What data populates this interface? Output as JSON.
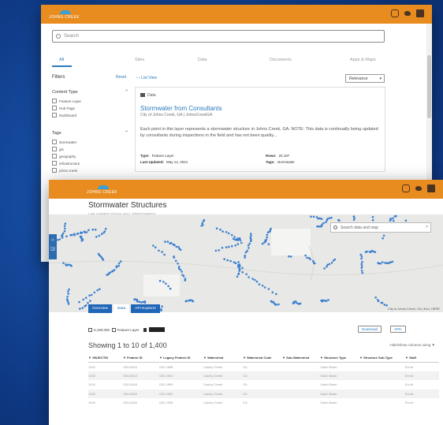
{
  "brand": {
    "logo_text": "JOHNS CREEK",
    "social_icons": [
      "instagram-icon",
      "twitter-icon",
      "facebook-icon"
    ],
    "colors": {
      "header": "#e88c1f",
      "accent": "#2a7ab9",
      "tab_blue": "#1f65b8",
      "background": "#174ea3",
      "map_points": "#3d7fd0"
    }
  },
  "search_page": {
    "search_placeholder": "Search",
    "tabs": [
      "All",
      "Sites",
      "Data",
      "Documents",
      "Apps & Maps"
    ],
    "active_tab": "All",
    "filters_heading": "Filters",
    "reset_label": "Reset",
    "list_toggle": "List View",
    "sort_label": "Relevance",
    "content_type": {
      "heading": "Content Type",
      "options": [
        "Feature Layer",
        "Hub Page",
        "Dashboard"
      ]
    },
    "tags": {
      "heading": "Tags",
      "options": [
        "stormwater",
        "gis",
        "geography",
        "infrastructure",
        "johns creek"
      ]
    },
    "result": {
      "badge": "Data",
      "title": "Stormwater from Consultants",
      "owner": "City of Johns Creek, GA | JohnsCreekGA",
      "description": "Each point in this layer represents a stormwater structure in Johns Creek, GA.  NOTE:  This data is continually being updated by consultants during inspections in the field and has not been quality...",
      "type_label": "Type:",
      "type_value": "Feature Layer",
      "updated_label": "Last Updated:",
      "updated_value": "May 14, 2021",
      "rows_label": "Rows:",
      "rows_value": "20,187",
      "tags_label": "Tags:",
      "tags_value": "stormwater"
    }
  },
  "dataset_page": {
    "title": "Stormwater Structures",
    "subtitle": "Last updated 3 hours ago | JohnsCreekGA",
    "map_search_placeholder": "Search data and map",
    "map_attribution": "City of Johns Creek, GA | Esri, HERE",
    "tabs": [
      "Overview",
      "Data",
      "API Explorer"
    ],
    "active_tab": "Data",
    "download_rows": "5,190,000",
    "download_layer": "Feature Layer",
    "download_button": "Download",
    "apis_button": "APIs",
    "showing": "Showing 1 to 10 of 1,400",
    "columns_label": "Hide/Show columns using",
    "table": {
      "headers": [
        "OBJECTID",
        "Feature ID",
        "Legacy Feature ID",
        "Watershed",
        "Watershed Code",
        "Sub-Watershed",
        "Structure Type",
        "Structure Sub-Type",
        "Staff"
      ],
      "rows": [
        [
          "1002",
          "CB1/4343",
          "GID-1898",
          "Cauley Creek",
          "CA",
          "",
          "Catch Basin",
          "",
          "Ext Ar"
        ],
        [
          "1003",
          "CB1/4343",
          "GID-1901",
          "Cauley Creek",
          "CA",
          "",
          "Catch Basin",
          "",
          "Ext Ar"
        ],
        [
          "1004",
          "CB1/4345",
          "GID-1899",
          "Cauley Creek",
          "CA",
          "",
          "Catch Basin",
          "",
          "Ext Ar"
        ],
        [
          "1005",
          "CB1/4345",
          "GID-1902",
          "Cauley Creek",
          "CA",
          "",
          "Catch Basin",
          "",
          "Ext Ar"
        ],
        [
          "1006",
          "CB1/4345",
          "GID-1905",
          "Cauley Creek",
          "CA",
          "",
          "Catch Basin",
          "",
          "Ext Ar"
        ]
      ]
    }
  }
}
